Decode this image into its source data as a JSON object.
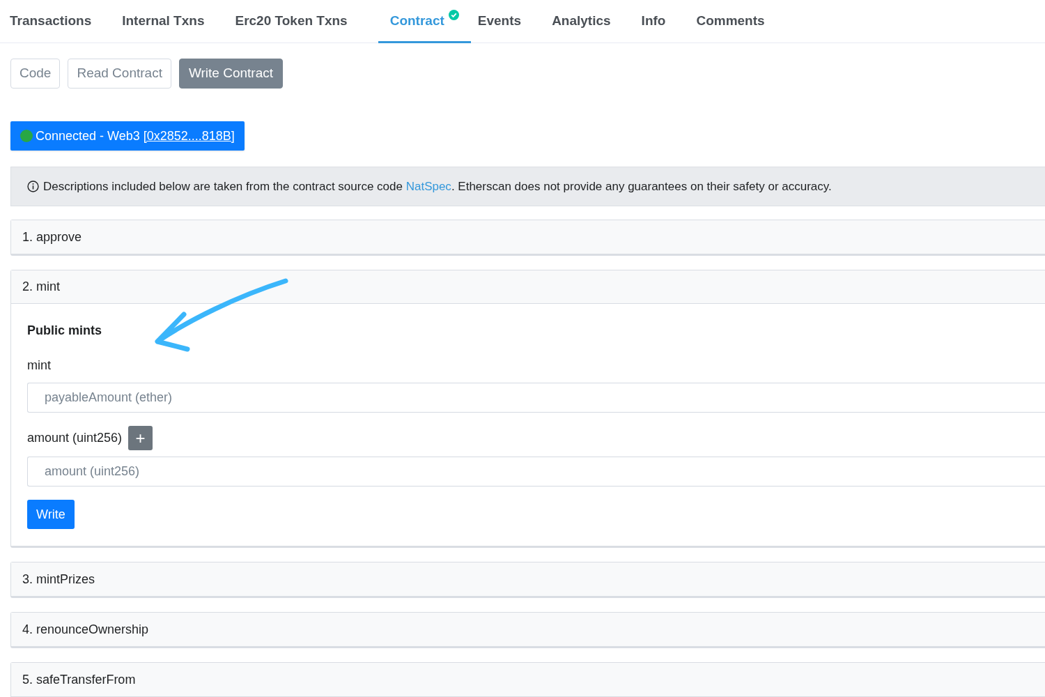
{
  "tabs": [
    {
      "label": "Transactions",
      "selected": false,
      "verified": false
    },
    {
      "label": "Internal Txns",
      "selected": false,
      "verified": false
    },
    {
      "label": "Erc20 Token Txns",
      "selected": false,
      "verified": false
    },
    {
      "label": "Contract",
      "selected": true,
      "verified": true
    },
    {
      "label": "Events",
      "selected": false,
      "verified": false
    },
    {
      "label": "Analytics",
      "selected": false,
      "verified": false
    },
    {
      "label": "Info",
      "selected": false,
      "verified": false
    },
    {
      "label": "Comments",
      "selected": false,
      "verified": false
    }
  ],
  "sub_tabs": [
    {
      "label": "Code",
      "selected": false
    },
    {
      "label": "Read Contract",
      "selected": false
    },
    {
      "label": "Write Contract",
      "selected": true
    }
  ],
  "connection": {
    "connected": true,
    "label": "Connected - Web3",
    "address": "[0x2852....818B]"
  },
  "notice": {
    "before": "Descriptions included below are taken from the contract source code",
    "link": "NatSpec",
    "after": ". Etherscan does not provide any guarantees on their safety or accuracy."
  },
  "functions": [
    {
      "title": "1. approve",
      "expanded": false
    },
    {
      "title": "2. mint",
      "expanded": true,
      "heading": "Public mints",
      "method": "mint",
      "payable_placeholder": "payableAmount (ether)",
      "params": [
        {
          "label": "amount (uint256)",
          "add_button": "+",
          "placeholder": "amount (uint256)"
        }
      ],
      "button": "Write"
    },
    {
      "title": "3. mintPrizes",
      "expanded": false
    },
    {
      "title": "4. renounceOwnership",
      "expanded": false
    },
    {
      "title": "5. safeTransferFrom",
      "expanded": false
    }
  ]
}
